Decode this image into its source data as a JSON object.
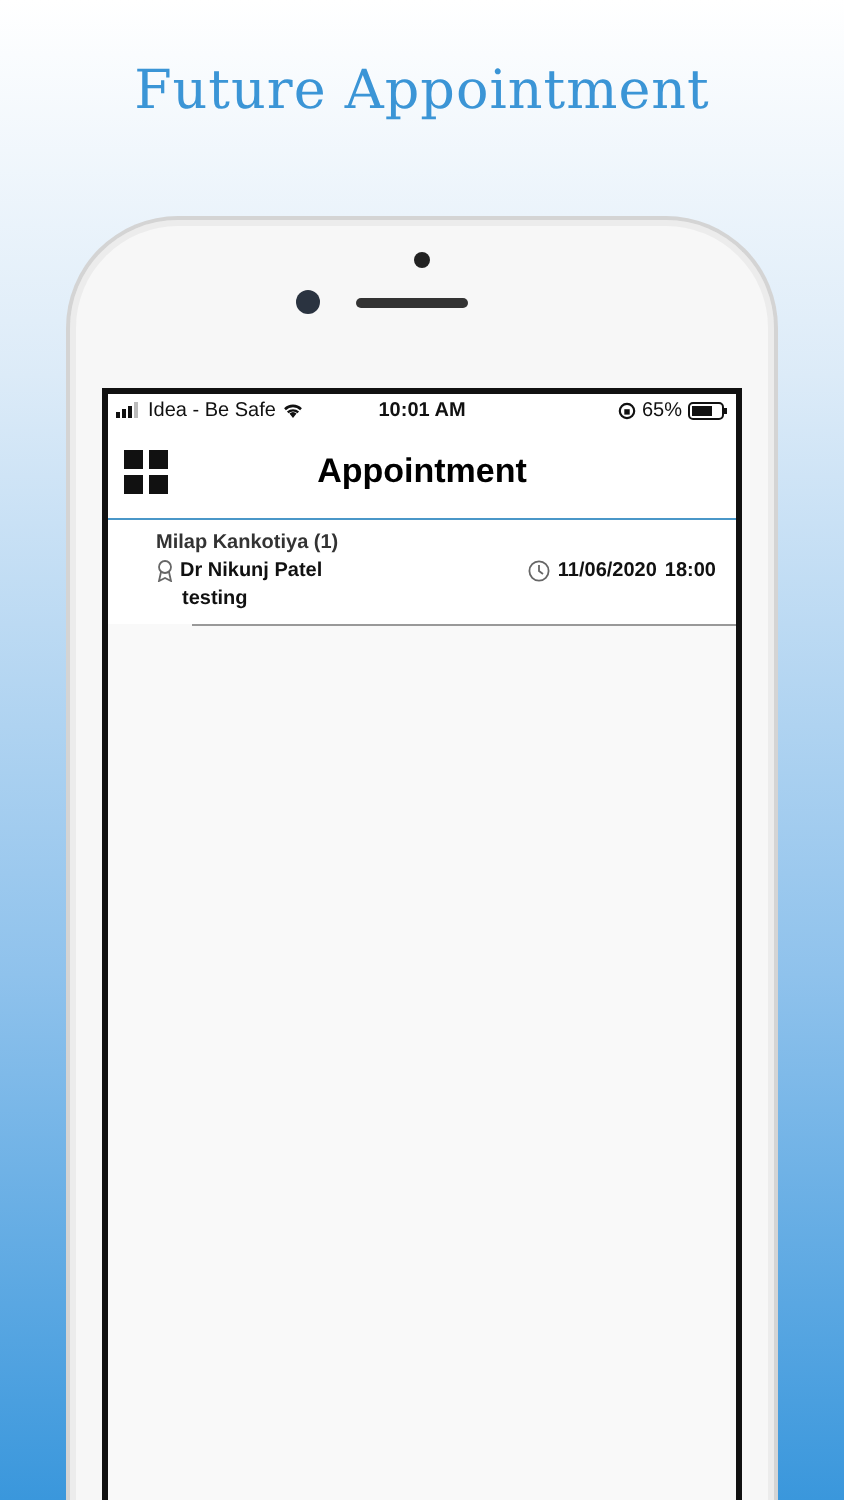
{
  "headline": "Future Appointment",
  "status_bar": {
    "carrier": "Idea - Be Safe",
    "time": "10:01 AM",
    "battery": "65%"
  },
  "header": {
    "title": "Appointment"
  },
  "appointments": [
    {
      "patient": "Milap Kankotiya (1)",
      "doctor": "Dr Nikunj Patel",
      "date": "11/06/2020",
      "time": "18:00",
      "note": "testing"
    }
  ]
}
